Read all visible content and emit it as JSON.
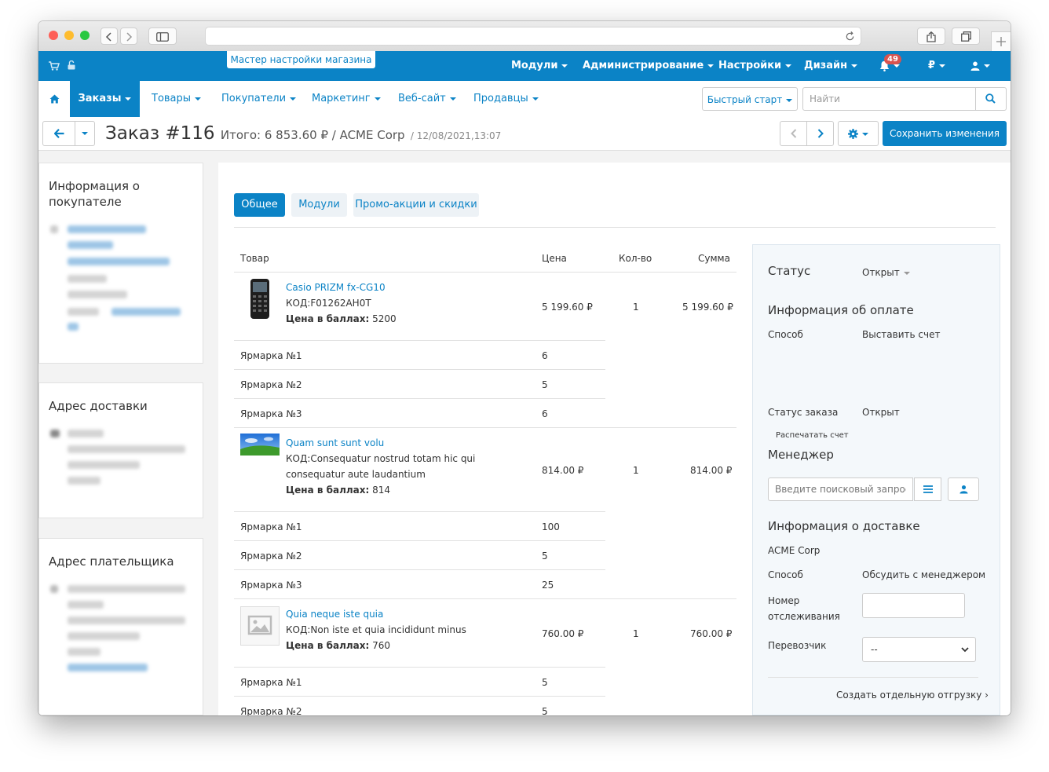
{
  "browser": {
    "url": ""
  },
  "topbar": {
    "wizard": "Мастер настройки магазина",
    "menu": [
      "Модули",
      "Администрирование",
      "Настройки",
      "Дизайн"
    ],
    "notifications_count": "49",
    "currency": "₽"
  },
  "nav": {
    "items": [
      "Заказы",
      "Товары",
      "Покупатели",
      "Маркетинг",
      "Веб-сайт",
      "Продавцы"
    ],
    "quick_start": "Быстрый старт",
    "search_placeholder": "Найти"
  },
  "order": {
    "title": "Заказ #116",
    "total": "Итого: 6 853.60 ₽ / ACME Corp",
    "date": "/ 12/08/2021,13:07",
    "save": "Сохранить изменения"
  },
  "customer": {
    "heading": "Информация о покупателе"
  },
  "shipping_address": {
    "heading": "Адрес доставки"
  },
  "billing_address": {
    "heading": "Адрес плательщика"
  },
  "tabs": [
    "Общее",
    "Модули",
    "Промо-акции и скидки"
  ],
  "table": {
    "headers": {
      "product": "Товар",
      "price": "Цена",
      "qty": "Кол-во",
      "sum": "Сумма"
    },
    "products": [
      {
        "name": "Casio PRIZM fx-CG10",
        "code": "КОД:F01262AH0T",
        "code2": "",
        "points_label": "Цена в баллах:",
        "points": "5200",
        "price": "5 199.60 ₽",
        "qty": "1",
        "sum": "5 199.60 ₽",
        "warehouses": [
          {
            "name": "Ярмарка №1",
            "qty": "6"
          },
          {
            "name": "Ярмарка №2",
            "qty": "5"
          },
          {
            "name": "Ярмарка №3",
            "qty": "6"
          }
        ]
      },
      {
        "name": "Quam sunt sunt volu",
        "code": "КОД:Consequatur nostrud totam hic qui",
        "code2": "consequatur aute laudantium",
        "points_label": "Цена в баллах:",
        "points": "814",
        "price": "814.00 ₽",
        "qty": "1",
        "sum": "814.00 ₽",
        "warehouses": [
          {
            "name": "Ярмарка №1",
            "qty": "100"
          },
          {
            "name": "Ярмарка №2",
            "qty": "5"
          },
          {
            "name": "Ярмарка №3",
            "qty": "25"
          }
        ]
      },
      {
        "name": "Quia neque iste quia",
        "code": "КОД:Non iste et quia incididunt minus",
        "code2": "",
        "points_label": "Цена в баллах:",
        "points": "760",
        "price": "760.00 ₽",
        "qty": "1",
        "sum": "760.00 ₽",
        "warehouses": [
          {
            "name": "Ярмарка №1",
            "qty": "5"
          },
          {
            "name": "Ярмарка №2",
            "qty": "5"
          }
        ]
      }
    ]
  },
  "sidebar": {
    "status_label": "Статус",
    "status_value": "Открыт",
    "payment_heading": "Информация об оплате",
    "method_label": "Способ",
    "method_value": "Выставить счет",
    "order_status_label": "Статус заказа",
    "order_status_value": "Открыт",
    "print_invoice": "Распечатать счет",
    "manager_heading": "Менеджер",
    "manager_placeholder": "Введите поисковый запрос...",
    "delivery_heading": "Информация о доставке",
    "company": "ACME Corp",
    "delivery_method_label": "Способ",
    "delivery_method_value": "Обсудить с менеджером",
    "tracking_label_1": "Номер",
    "tracking_label_2": "отслеживания",
    "carrier_label": "Перевозчик",
    "carrier_value": "--",
    "create_shipment": "Создать отдельную отгрузку ›"
  }
}
